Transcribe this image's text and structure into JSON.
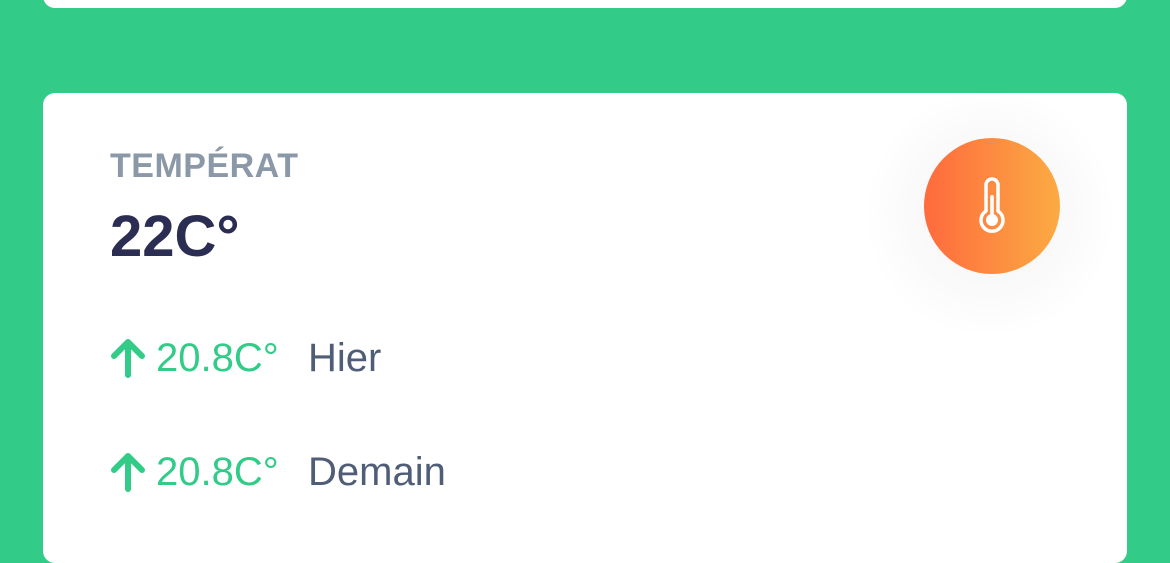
{
  "card": {
    "title": "TEMPÉRAT",
    "value": "22C°",
    "icon": "thermometer-icon",
    "icon_gradient": [
      "#ff6a3d",
      "#fbab43"
    ]
  },
  "stats": [
    {
      "value": "20.8C°",
      "label": "Hier",
      "trend": "up"
    },
    {
      "value": "20.8C°",
      "label": "Demain",
      "trend": "up"
    }
  ],
  "colors": {
    "background": "#32cb88",
    "accent": "#32cb88",
    "title": "#8a98a8",
    "value": "#2b2d52",
    "label": "#4f5d77"
  }
}
